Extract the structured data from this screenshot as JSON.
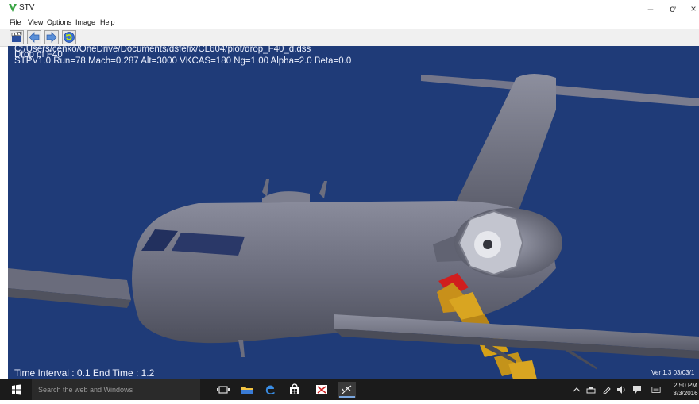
{
  "window": {
    "title": "STV",
    "minimize_glyph": "–",
    "maximize_glyph": "ơ",
    "close_glyph": "×"
  },
  "menu": [
    "File",
    "View",
    "Options",
    "Image",
    "Help"
  ],
  "toolbar": {
    "buttons": [
      "film-clapper-icon",
      "arrow-left-icon",
      "arrow-right-icon",
      "refresh-icon"
    ]
  },
  "viewport": {
    "file_path": "C:/Users/cenko/OneDrive/Documents/dsfefix/CL604/plot/drop_F40_d.dss",
    "case_title": "Drop of F40",
    "status": "STPV1.0  Run=78 Mach=0.287 Alt=3000 VKCAS=180 Ng=1.00 Alpha=2.0 Beta=0.0",
    "time_info": "Time Interval : 0.1  End Time : 1.2",
    "version": "Ver 1.3 03/03/1",
    "background_color": "#1f3b78",
    "aircraft_color": "#6e7080",
    "store_color": "#d4a017"
  },
  "taskbar": {
    "search_placeholder": "Search the web and Windows",
    "apps": [
      "task-view-icon",
      "file-explorer-icon",
      "edge-icon",
      "store-icon",
      "app-icon",
      "stv-icon"
    ],
    "tray": [
      "chevron-up-icon",
      "network-icon",
      "pen-icon",
      "volume-icon",
      "notification-icon",
      "keyboard-icon"
    ],
    "time": "2:50 PM",
    "date": "3/3/2016"
  }
}
